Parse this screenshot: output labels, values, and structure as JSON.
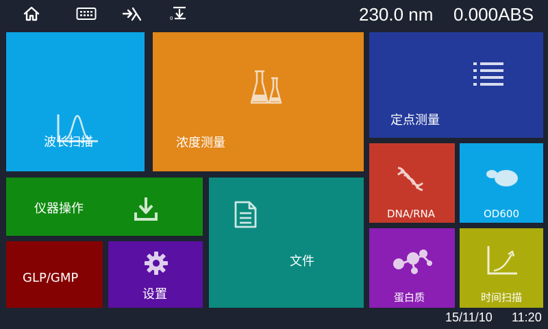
{
  "topbar": {
    "icons": [
      "home-icon",
      "keyboard-icon",
      "lambda-goto-icon",
      "zero-baseline-icon"
    ],
    "wavelength": "230.0 nm",
    "absorbance": "0.000ABS"
  },
  "tiles": {
    "wavelength_scan": {
      "label": "波长扫描",
      "color": "#0ba5e6",
      "icon": "peak-chart-icon"
    },
    "concentration": {
      "label": "浓度测量",
      "color": "#e2871a",
      "icon": "flask-icon"
    },
    "fixed_point": {
      "label": "定点测量",
      "color": "#233a9a",
      "icon": "list-icon"
    },
    "instrument_ops": {
      "label": "仪器操作",
      "color": "#118a11",
      "icon": "download-icon"
    },
    "file": {
      "label": "文件",
      "color": "#0d8a80",
      "icon": "document-icon"
    },
    "dna_rna": {
      "label": "DNA/RNA",
      "color": "#c5392a",
      "icon": "dna-icon"
    },
    "od600": {
      "label": "OD600",
      "color": "#0ba5e6",
      "icon": "cell-icon"
    },
    "glp_gmp": {
      "label": "GLP/GMP",
      "color": "#850202",
      "icon": ""
    },
    "settings": {
      "label": "设置",
      "color": "#5a10a3",
      "icon": "gear-icon"
    },
    "protein": {
      "label": "蛋白质",
      "color": "#8b1fb3",
      "icon": "molecule-icon"
    },
    "time_scan": {
      "label": "时间扫描",
      "color": "#adac0d",
      "icon": "curve-chart-icon"
    }
  },
  "footer": {
    "date": "15/11/10",
    "time": "11:20"
  }
}
